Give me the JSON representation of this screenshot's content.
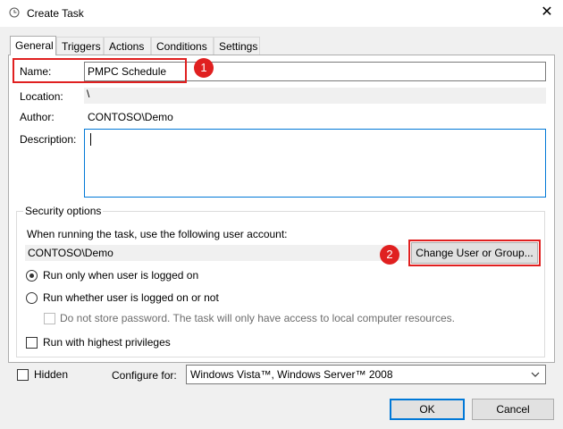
{
  "window": {
    "title": "Create Task",
    "close_icon": "✕"
  },
  "tabs": [
    {
      "label": "General",
      "active": true
    },
    {
      "label": "Triggers",
      "active": false
    },
    {
      "label": "Actions",
      "active": false
    },
    {
      "label": "Conditions",
      "active": false
    },
    {
      "label": "Settings",
      "active": false
    }
  ],
  "general": {
    "name_label": "Name:",
    "name_value": "PMPC Schedule",
    "location_label": "Location:",
    "location_value": "\\",
    "author_label": "Author:",
    "author_value": "CONTOSO\\Demo",
    "description_label": "Description:",
    "description_value": ""
  },
  "security": {
    "legend": "Security options",
    "account_prompt": "When running the task, use the following user account:",
    "account_value": "CONTOSO\\Demo",
    "change_button": "Change User or Group...",
    "radio_logged_on": "Run only when user is logged on",
    "radio_whether": "Run whether user is logged on or not",
    "no_store_password": "Do not store password.  The task will only have access to local computer resources.",
    "highest_privileges": "Run with highest privileges"
  },
  "footer": {
    "hidden_label": "Hidden",
    "configure_label": "Configure for:",
    "configure_value": "Windows Vista™, Windows Server™ 2008",
    "ok_label": "OK",
    "cancel_label": "Cancel"
  },
  "annotations": {
    "badge1": "1",
    "badge2": "2",
    "highlight_color": "#e02020"
  }
}
